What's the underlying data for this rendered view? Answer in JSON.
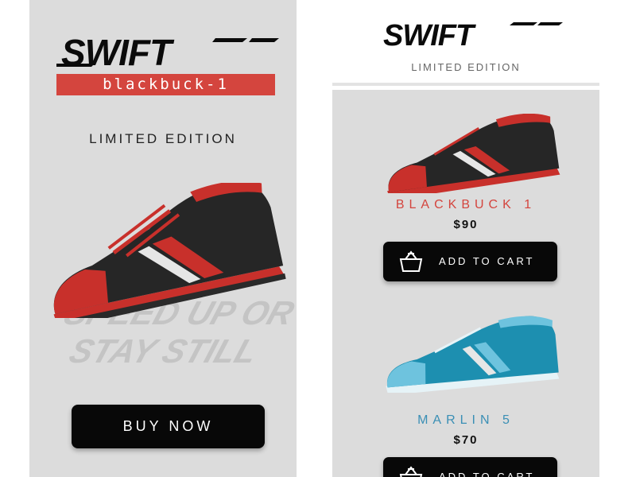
{
  "brand": {
    "name": "SWIFT"
  },
  "left_screen": {
    "model_banner": "blackbuck-1",
    "edition": "LIMITED EDITION",
    "tagline_line1": "SPEED UP OR",
    "tagline_line2": "STAY STILL",
    "buy_label": "BUY NOW"
  },
  "right_screen": {
    "edition": "LIMITED EDITION",
    "products": [
      {
        "name": "BLACKBUCK 1",
        "price": "$90",
        "cart_label": "ADD TO CART",
        "name_color": "#d4453e",
        "shoe_color": "#2a2a2a",
        "accent_color": "#c8302b"
      },
      {
        "name": "MARLIN 5",
        "price": "$70",
        "cart_label": "ADD TO CART",
        "name_color": "#3a8fb5",
        "shoe_color": "#1d8fb0",
        "accent_color": "#6ec3de"
      }
    ]
  },
  "icons": [
    "basket-icon",
    "swift-logo",
    "shoe-image"
  ]
}
